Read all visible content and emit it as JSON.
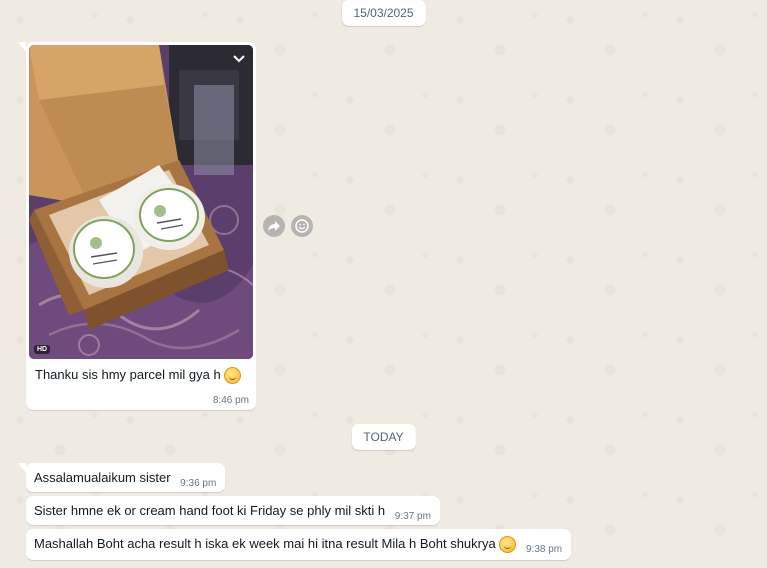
{
  "chat": {
    "date_top": "15/03/2025",
    "date_today": "TODAY",
    "image_message": {
      "hd_badge": "HD",
      "caption": "Thanku sis hmy parcel mil gya h",
      "emoji": "smiling-face-with-halo-icon",
      "time": "8:46 pm"
    },
    "messages": [
      {
        "text": "Assalamualaikum sister",
        "time": "9:36 pm"
      },
      {
        "text": "Sister hmne ek or cream hand foot ki Friday se phly mil skti h",
        "time": "9:37 pm"
      },
      {
        "text": "Mashallah Boht acha result h iska ek week mai hi itna result Mila h Boht shukrya",
        "time": "9:38 pm",
        "emoji": "smiling-face-with-halo-icon"
      }
    ],
    "icons": {
      "menu": "chevron-down-icon",
      "forward": "forward-icon",
      "react": "emoji-react-icon"
    },
    "colors": {
      "wallpaper": "#efeae2",
      "bubble": "#ffffff",
      "timestamp": "#667781"
    }
  }
}
